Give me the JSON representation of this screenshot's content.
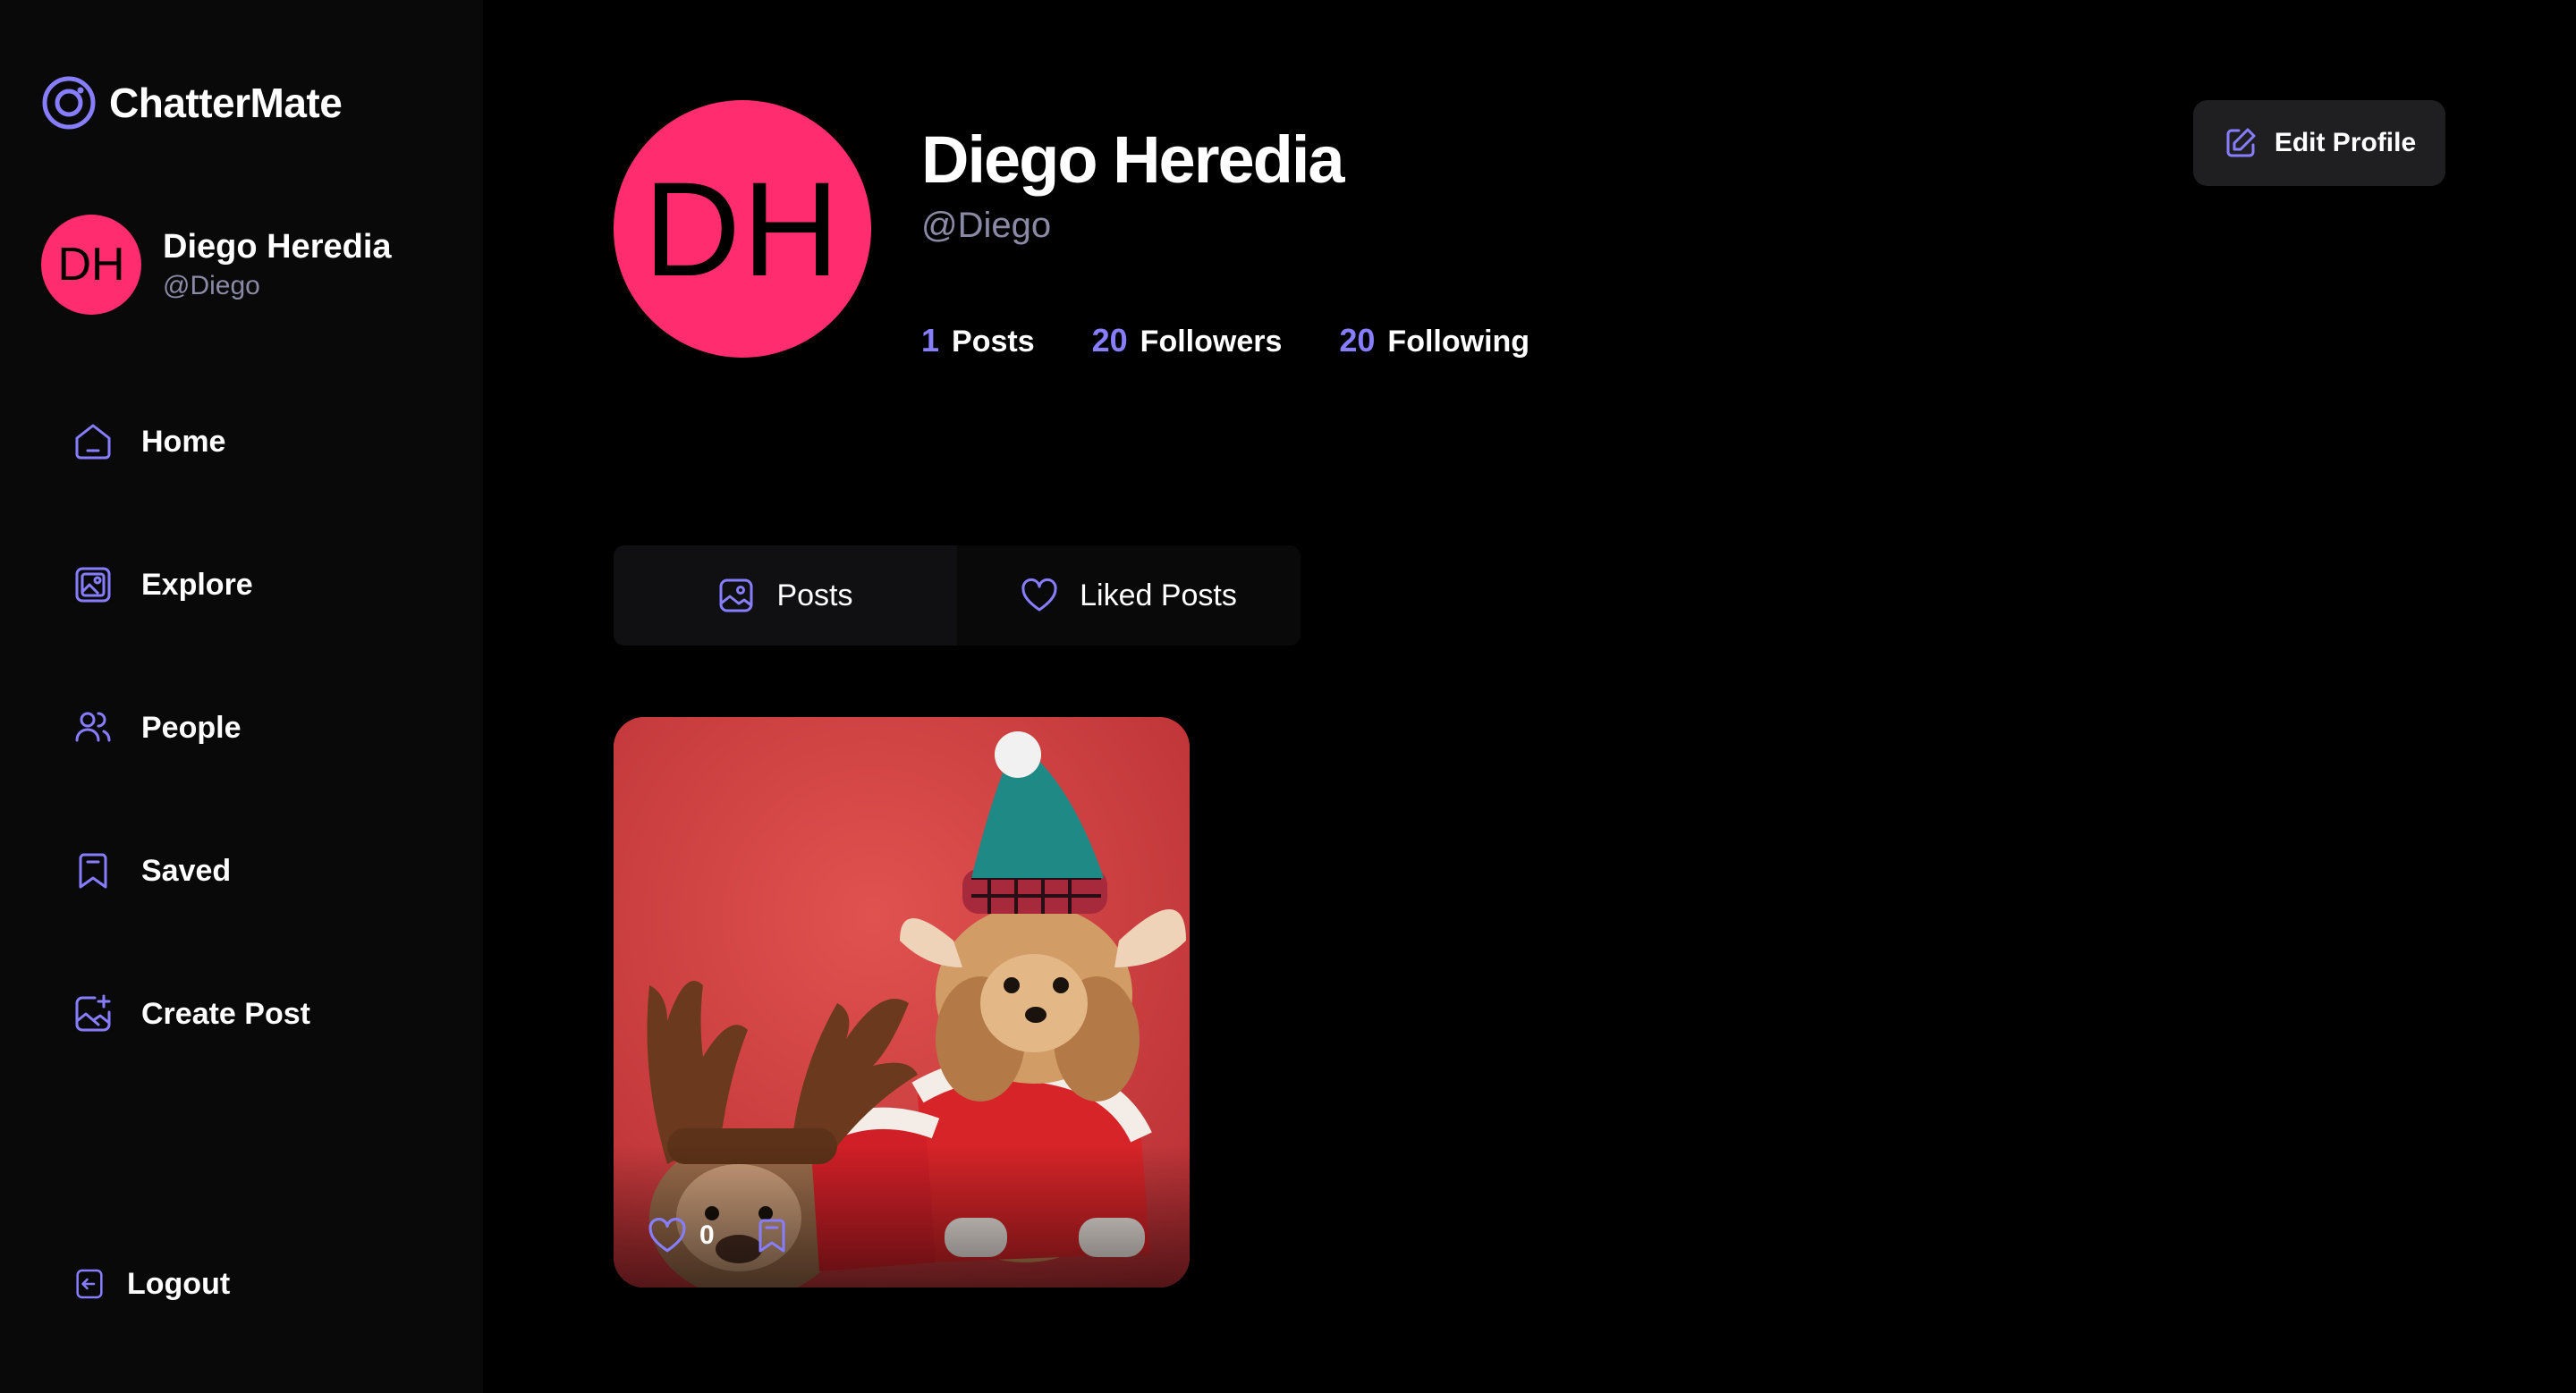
{
  "app": {
    "name": "ChatterMate",
    "accent": "#877eff",
    "avatar_color": "#ff2d6f"
  },
  "sidebar": {
    "user": {
      "initials": "DH",
      "name": "Diego Heredia",
      "handle": "@Diego"
    },
    "items": [
      {
        "label": "Home",
        "icon": "home-icon"
      },
      {
        "label": "Explore",
        "icon": "gallery-icon"
      },
      {
        "label": "People",
        "icon": "people-icon"
      },
      {
        "label": "Saved",
        "icon": "bookmark-icon"
      },
      {
        "label": "Create Post",
        "icon": "add-image-icon"
      }
    ],
    "logout_label": "Logout"
  },
  "profile": {
    "initials": "DH",
    "name": "Diego Heredia",
    "handle": "@Diego",
    "edit_label": "Edit Profile",
    "stats": [
      {
        "value": "1",
        "label": "Posts"
      },
      {
        "value": "20",
        "label": "Followers"
      },
      {
        "value": "20",
        "label": "Following"
      }
    ]
  },
  "tabs": [
    {
      "label": "Posts",
      "icon": "posts-icon",
      "active": true
    },
    {
      "label": "Liked Posts",
      "icon": "heart-icon",
      "active": false
    }
  ],
  "posts": [
    {
      "image": "two dogs in christmas costumes on red background",
      "likes": "0"
    }
  ]
}
